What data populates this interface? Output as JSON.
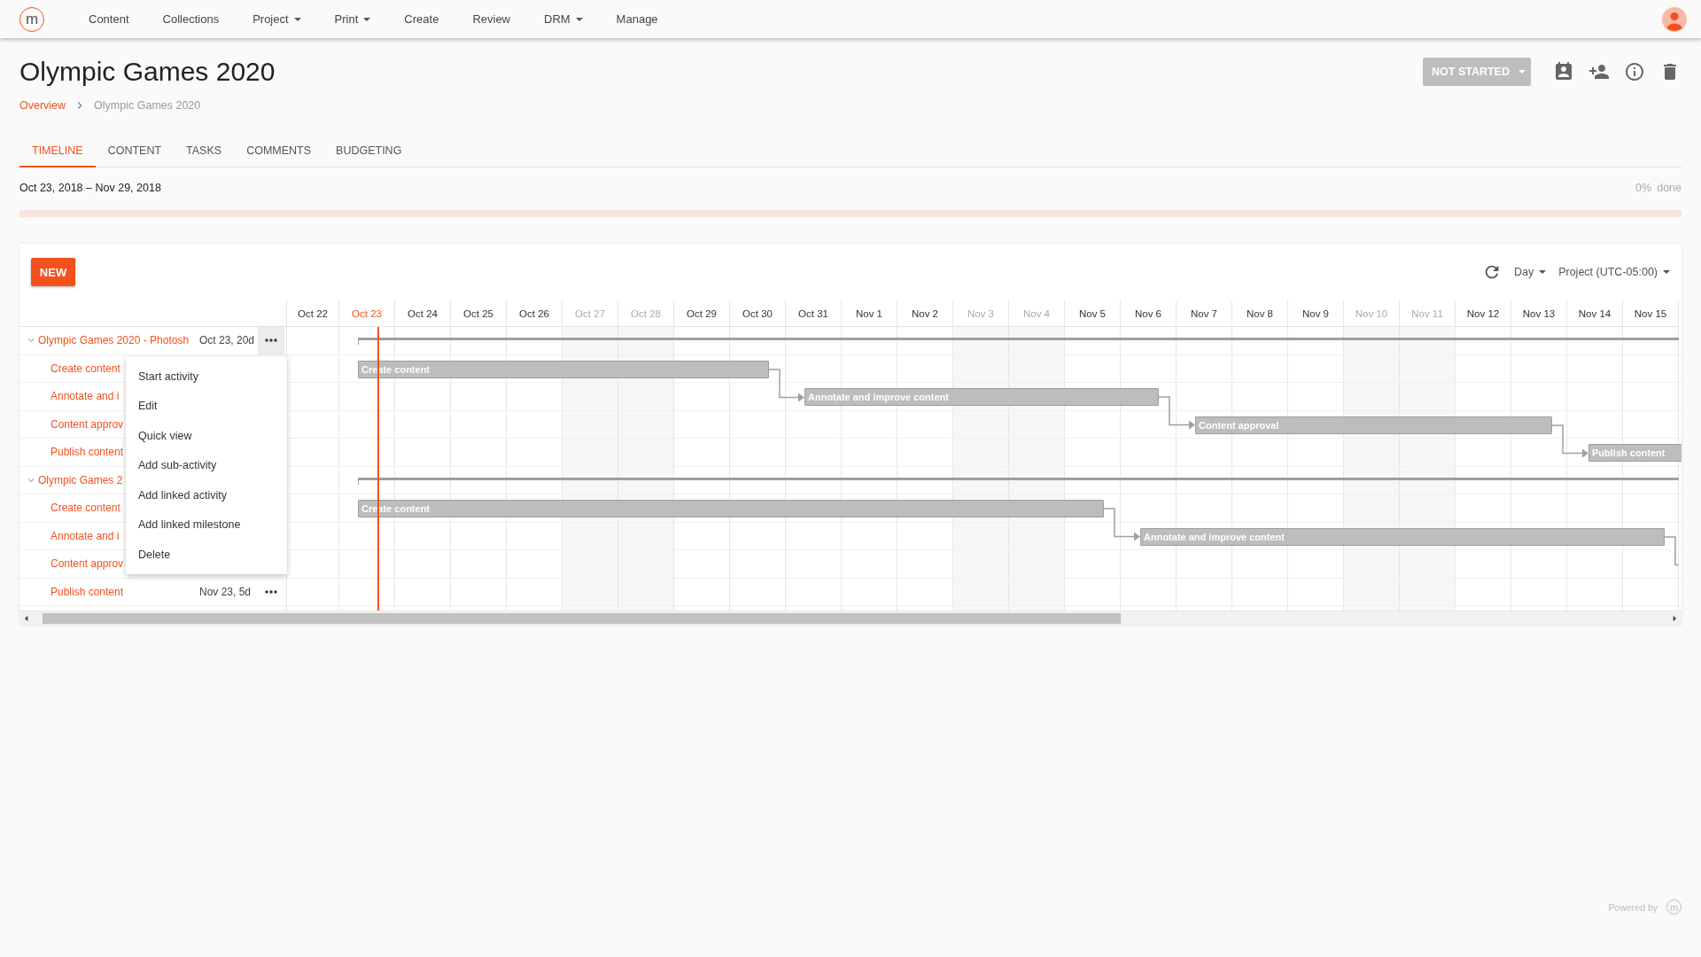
{
  "logo": "m",
  "nav": [
    {
      "label": "Content",
      "dropdown": false
    },
    {
      "label": "Collections",
      "dropdown": false
    },
    {
      "label": "Project",
      "dropdown": true
    },
    {
      "label": "Print",
      "dropdown": true
    },
    {
      "label": "Create",
      "dropdown": false
    },
    {
      "label": "Review",
      "dropdown": false
    },
    {
      "label": "DRM",
      "dropdown": true
    },
    {
      "label": "Manage",
      "dropdown": false
    }
  ],
  "page": {
    "title": "Olympic Games 2020",
    "status": "NOT STARTED"
  },
  "breadcrumb": [
    "Overview",
    "Olympic Games 2020"
  ],
  "tabs": [
    {
      "label": "TIMELINE",
      "selected": true
    },
    {
      "label": "CONTENT",
      "selected": false
    },
    {
      "label": "TASKS",
      "selected": false
    },
    {
      "label": "COMMENTS",
      "selected": false
    },
    {
      "label": "BUDGETING",
      "selected": false
    }
  ],
  "date_range": "Oct 23, 2018 – Nov 29, 2018",
  "progress": {
    "percent": "0%",
    "label": "done",
    "level": 0
  },
  "timeline": {
    "new_button": "NEW",
    "view": "Day",
    "timezone": "Project (UTC-05:00)",
    "days": [
      {
        "label": "Oct 22",
        "weekend": false,
        "today": false
      },
      {
        "label": "Oct 23",
        "weekend": false,
        "today": true
      },
      {
        "label": "Oct 24",
        "weekend": false,
        "today": false
      },
      {
        "label": "Oct 25",
        "weekend": false,
        "today": false
      },
      {
        "label": "Oct 26",
        "weekend": false,
        "today": false
      },
      {
        "label": "Oct 27",
        "weekend": true,
        "today": false
      },
      {
        "label": "Oct 28",
        "weekend": true,
        "today": false
      },
      {
        "label": "Oct 29",
        "weekend": false,
        "today": false
      },
      {
        "label": "Oct 30",
        "weekend": false,
        "today": false
      },
      {
        "label": "Oct 31",
        "weekend": false,
        "today": false
      },
      {
        "label": "Nov 1",
        "weekend": false,
        "today": false
      },
      {
        "label": "Nov 2",
        "weekend": false,
        "today": false
      },
      {
        "label": "Nov 3",
        "weekend": true,
        "today": false
      },
      {
        "label": "Nov 4",
        "weekend": true,
        "today": false
      },
      {
        "label": "Nov 5",
        "weekend": false,
        "today": false
      },
      {
        "label": "Nov 6",
        "weekend": false,
        "today": false
      },
      {
        "label": "Nov 7",
        "weekend": false,
        "today": false
      },
      {
        "label": "Nov 8",
        "weekend": false,
        "today": false
      },
      {
        "label": "Nov 9",
        "weekend": false,
        "today": false
      },
      {
        "label": "Nov 10",
        "weekend": true,
        "today": false
      },
      {
        "label": "Nov 11",
        "weekend": true,
        "today": false
      },
      {
        "label": "Nov 12",
        "weekend": false,
        "today": false
      },
      {
        "label": "Nov 13",
        "weekend": false,
        "today": false
      },
      {
        "label": "Nov 14",
        "weekend": false,
        "today": false
      },
      {
        "label": "Nov 15",
        "weekend": false,
        "today": false
      }
    ],
    "rows": [
      {
        "kind": "group",
        "name": "Olympic Games 2020 - Photosh",
        "date": "Oct 23, 20d",
        "expanded": true,
        "menu_open": true
      },
      {
        "kind": "task",
        "name": "Create content",
        "bar": "Create content"
      },
      {
        "kind": "task",
        "name": "Annotate and i",
        "bar": "Annotate and improve content"
      },
      {
        "kind": "task",
        "name": "Content approv",
        "bar": "Content approval"
      },
      {
        "kind": "task",
        "name": "Publish content",
        "bar": "Publish content"
      },
      {
        "kind": "group",
        "name": "Olympic Games 2",
        "expanded": true
      },
      {
        "kind": "task",
        "name": "Create content",
        "bar": "Create content"
      },
      {
        "kind": "task",
        "name": "Annotate and i",
        "bar": "Annotate and improve content"
      },
      {
        "kind": "task",
        "name": "Content approv"
      },
      {
        "kind": "task",
        "name": "Publish content",
        "date": "Nov 23, 5d",
        "menu_open": false
      }
    ],
    "menu": [
      "Start activity",
      "Edit",
      "Quick view",
      "Add sub-activity",
      "Add linked activity",
      "Add linked milestone",
      "Delete"
    ]
  },
  "footer": {
    "powered_by": "Powered by",
    "logo": "m"
  }
}
